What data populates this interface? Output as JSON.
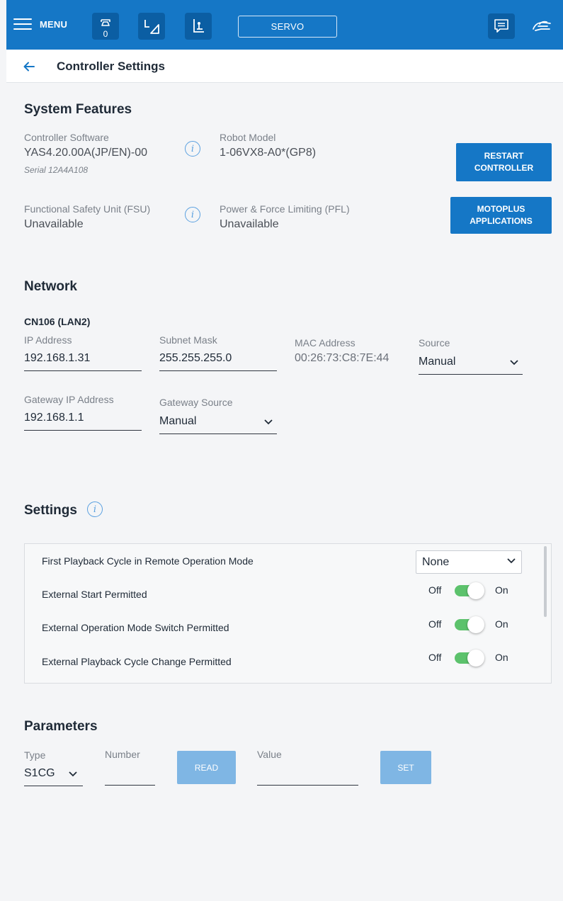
{
  "topbar": {
    "menu_label": "MENU",
    "icons": [
      "robot-arm-icon",
      "coordinate-frame-icon",
      "tool-frame-icon"
    ],
    "robot_count": "0",
    "servo_label": "SERVO",
    "right_icons": [
      "message-icon",
      "teach-hand-icon"
    ],
    "color": "#1577c6"
  },
  "header": {
    "title": "Controller Settings"
  },
  "system": {
    "title": "System Features",
    "software_label": "Controller Software",
    "software_value": "YAS4.20.00A(JP/EN)-00",
    "serial": "Serial 12A4A108",
    "robot_label": "Robot Model",
    "robot_value": "1-06VX8-A0*(GP8)",
    "restart_button": [
      "RESTART",
      "CONTROLLER"
    ],
    "fsu_label": "Functional Safety Unit (FSU)",
    "fsu_value": "Unavailable",
    "pfl_label": "Power & Force Limiting (PFL)",
    "pfl_value": "Unavailable",
    "motoplus_button": [
      "MOTOPLUS",
      "APPLICATIONS"
    ]
  },
  "network": {
    "title": "Network",
    "port": "CN106 (LAN2)",
    "ip_label": "IP Address",
    "ip_value": "192.168.1.31",
    "subnet_label": "Subnet Mask",
    "subnet_value": "255.255.255.0",
    "mac_label": "MAC Address",
    "mac_value": "00:26:73:C8:7E:44",
    "source_label": "Source",
    "source_value": "Manual",
    "gateway_label": "Gateway IP Address",
    "gateway_value": "192.168.1.1",
    "gateway_source_label": "Gateway Source",
    "gateway_source_value": "Manual"
  },
  "settings": {
    "title": "Settings",
    "rows": [
      {
        "label": "First Playback Cycle in Remote Operation Mode",
        "select": "None"
      },
      {
        "label": "External Start Permitted",
        "off": "Off",
        "on": "On",
        "state": true
      },
      {
        "label": "External Operation Mode Switch Permitted",
        "off": "Off",
        "on": "On",
        "state": true
      },
      {
        "label": "External Playback Cycle Change Permitted",
        "off": "Off",
        "on": "On",
        "state": true
      }
    ]
  },
  "parameters": {
    "title": "Parameters",
    "type_label": "Type",
    "type_value": "S1CG",
    "number_label": "Number",
    "number_value": "",
    "read_button": "READ",
    "value_label": "Value",
    "value_value": "",
    "set_button": "SET"
  }
}
